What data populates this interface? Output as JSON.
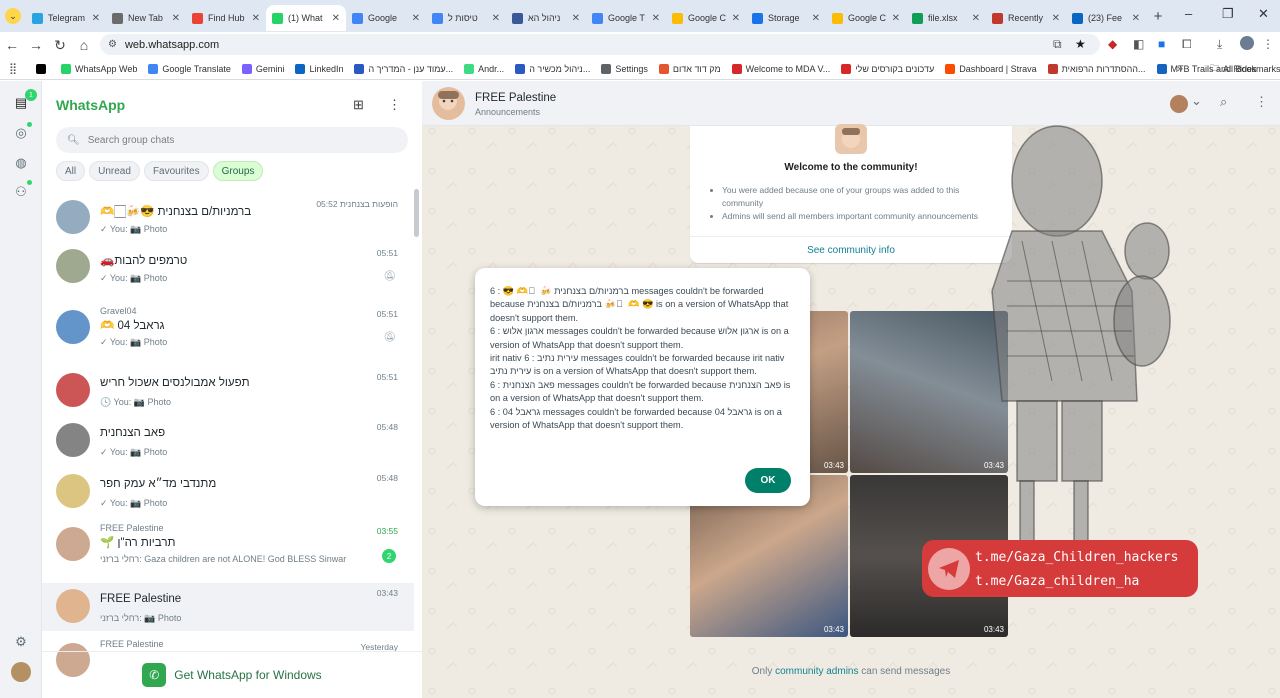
{
  "browser": {
    "tabs": [
      {
        "label": "Telegram",
        "color": "#2aa3e0",
        "active": false
      },
      {
        "label": "New Tab",
        "color": "#6b6b6b",
        "active": false
      },
      {
        "label": "Find Hub",
        "color": "#ea4335",
        "active": false
      },
      {
        "label": "(1) What",
        "color": "#25d366",
        "active": true
      },
      {
        "label": "Google",
        "color": "#4285f4",
        "active": false
      },
      {
        "label": "טיסות ל",
        "color": "#4285f4",
        "active": false
      },
      {
        "label": "ניהול הא",
        "color": "#3b5998",
        "active": false
      },
      {
        "label": "Google T",
        "color": "#4285f4",
        "active": false
      },
      {
        "label": "Google C",
        "color": "#fbbc05",
        "active": false
      },
      {
        "label": "Storage",
        "color": "#1a73e8",
        "active": false
      },
      {
        "label": "Google C",
        "color": "#fbbc05",
        "active": false
      },
      {
        "label": "file.xlsx",
        "color": "#0f9d58",
        "active": false
      },
      {
        "label": "Recently",
        "color": "#c0392b",
        "active": false
      },
      {
        "label": "(23) Fee",
        "color": "#0a66c2",
        "active": false
      }
    ],
    "url": "web.whatsapp.com",
    "bookmarks": [
      {
        "label": "",
        "color": "#000000"
      },
      {
        "label": "WhatsApp Web",
        "color": "#25d366"
      },
      {
        "label": "Google Translate",
        "color": "#4285f4"
      },
      {
        "label": "Gemini",
        "color": "#7b61ff"
      },
      {
        "label": "LinkedIn",
        "color": "#0a66c2"
      },
      {
        "label": "עמוד ענן - המדריך ה...",
        "color": "#2b59c3"
      },
      {
        "label": "Andr...",
        "color": "#3ddc84"
      },
      {
        "label": "ניהול מכשיר ה...",
        "color": "#2b59c3"
      },
      {
        "label": "Settings",
        "color": "#5f6368"
      },
      {
        "label": "מק דוד אדום",
        "color": "#e4572e"
      },
      {
        "label": "Welcome to MDA V...",
        "color": "#d62828"
      },
      {
        "label": "עדכונים בקורסים שלי",
        "color": "#d62828"
      },
      {
        "label": "Dashboard | Strava",
        "color": "#fc4c02"
      },
      {
        "label": "ההסתדרות הרפואית...",
        "color": "#c0392b"
      },
      {
        "label": "MTB Trails and Rides",
        "color": "#1565c0"
      }
    ],
    "all_bookmarks": "All Bookmarks"
  },
  "whatsapp": {
    "title": "WhatsApp",
    "rail_badge": "1",
    "search_placeholder": "Search group chats",
    "filters": [
      "All",
      "Unread",
      "Favourites",
      "Groups"
    ],
    "active_filter": "Groups",
    "chats": [
      {
        "group": "",
        "name": "ברמניות/ם בצנחנית 😎🍻🏻🫶",
        "sub": "✓ You: 📷 Photo",
        "time": "05:52",
        "extra": "הופעות בצנחנית",
        "badge": "",
        "muted": false,
        "selected": false,
        "av": "#8ea6bd"
      },
      {
        "group": "",
        "name": "טרמפים להבות🚗",
        "sub": "✓ You: 📷 Photo",
        "time": "05:51",
        "extra": "",
        "badge": "",
        "muted": true,
        "selected": false,
        "av": "#9aa48a"
      },
      {
        "group": "Gravel04",
        "name": "גראבל 04 🫶",
        "sub": "✓ You: 📷 Photo",
        "time": "05:51",
        "extra": "",
        "badge": "",
        "muted": true,
        "selected": false,
        "av": "#5b8fc7"
      },
      {
        "group": "",
        "name": "תפעול אמבולנסים אשכול חריש",
        "sub": "🕓 You: 📷 Photo",
        "time": "05:51",
        "extra": "",
        "badge": "",
        "muted": false,
        "selected": false,
        "av": "#c94b4b"
      },
      {
        "group": "",
        "name": "פאב הצנחנית",
        "sub": "✓ You: 📷 Photo",
        "time": "05:48",
        "extra": "",
        "badge": "",
        "muted": false,
        "selected": false,
        "av": "#7d7d7d"
      },
      {
        "group": "",
        "name": "מתנדבי מד״א עמק חפר",
        "sub": "✓ You: 📷 Photo",
        "time": "05:48",
        "extra": "",
        "badge": "",
        "muted": false,
        "selected": false,
        "av": "#d9c27a"
      },
      {
        "group": "FREE Palestine",
        "name": "תרביות רה\"ן 🌱",
        "sub": "רחלי ברזני: Gaza children are not ALONE! God BLESS Sinwar",
        "time": "03:55",
        "extra": "",
        "badge": "2",
        "muted": false,
        "selected": false,
        "av": "#c9a48a"
      },
      {
        "group": "",
        "name": "FREE Palestine",
        "sub": "רחלי ברזני: 📷 Photo",
        "time": "03:43",
        "extra": "",
        "badge": "",
        "muted": false,
        "selected": true,
        "av": "#e0b08a"
      },
      {
        "group": "FREE Palestine",
        "name": "",
        "sub": "",
        "time": "Yesterday",
        "extra": "",
        "badge": "",
        "muted": false,
        "selected": false,
        "av": "#c9a48a"
      }
    ],
    "get_app": "Get WhatsApp for Windows"
  },
  "conversation": {
    "title": "FREE Palestine",
    "subtitle": "Announcements",
    "welcome_title": "Welcome to the community!",
    "welcome_points": [
      "You were added because one of your groups was added to this community",
      "Admins will send all members important community announcements"
    ],
    "welcome_link": "See community info",
    "photo_durations": [
      "03:43",
      "03:43",
      "03:43",
      "03:43"
    ],
    "footer_prefix": "Only ",
    "footer_link": "community admins",
    "footer_suffix": " can send messages"
  },
  "watermark_badge": {
    "line1": "t.me/Gaza_Children_hackers",
    "line2": "t.me/Gaza_children_ha"
  },
  "dialog": {
    "lines": [
      "6 : 😎 🫶 🏻 🍻 ברמניות/ם בצנחנית messages couldn't be forwarded because ברמניות/ם בצנחנית 🍻 🏻 🫶 😎 is on a version of WhatsApp that doesn't support them.",
      "6 : ארגון אלוש messages couldn't be forwarded because ארגון אלוש is on a version of WhatsApp that doesn't support them.",
      "irit nativ 6 : עירית נתיב messages couldn't be forwarded because irit nativ עירית נתיב is on a version of WhatsApp that doesn't support them.",
      "6 : פאב הצנחנית messages couldn't be forwarded because פאב הצנחנית is on a version of WhatsApp that doesn't support them.",
      "6 : גראבל 04 messages couldn't be forwarded because גראבל 04 is on a version of WhatsApp that doesn't support them."
    ],
    "ok_label": "OK"
  },
  "colors": {
    "accent": "#25a244",
    "ok_button": "#008069",
    "badge_red": "#d32f2f"
  }
}
